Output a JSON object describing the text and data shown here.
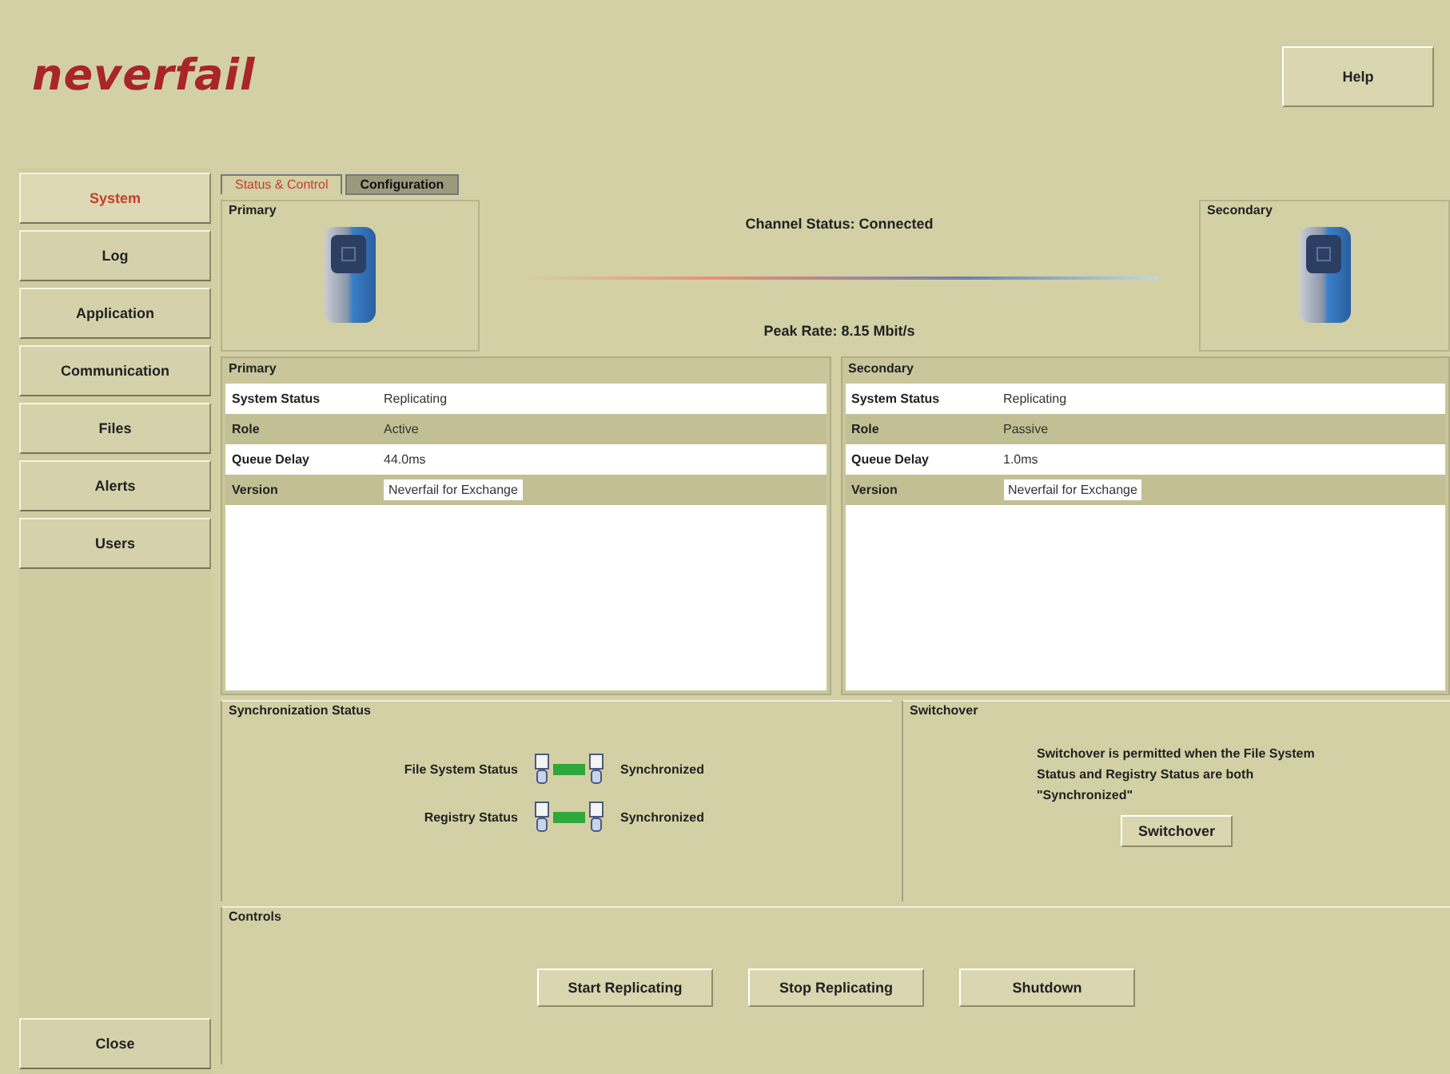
{
  "logo": "neverfail",
  "help_button": "Help",
  "sidebar": {
    "items": [
      {
        "label": "System",
        "selected": true
      },
      {
        "label": "Log",
        "selected": false
      },
      {
        "label": "Application",
        "selected": false
      },
      {
        "label": "Communication",
        "selected": false
      },
      {
        "label": "Files",
        "selected": false
      },
      {
        "label": "Alerts",
        "selected": false
      },
      {
        "label": "Users",
        "selected": false
      }
    ],
    "close_button": "Close"
  },
  "tabs": [
    {
      "label": "Status & Control",
      "selected": true
    },
    {
      "label": "Configuration",
      "selected": false
    }
  ],
  "channel": {
    "primary_title": "Primary",
    "secondary_title": "Secondary",
    "status": "Channel Status: Connected",
    "peak_rate": "Peak Rate: 8.15 Mbit/s"
  },
  "servers": [
    {
      "title": "Primary",
      "rows": [
        {
          "label": "System Status",
          "value": "Replicating",
          "kind": "text"
        },
        {
          "label": "Role",
          "value": "Active",
          "kind": "text"
        },
        {
          "label": "Queue Delay",
          "value": "44.0ms",
          "kind": "text"
        },
        {
          "label": "Version",
          "value": "Neverfail for Exchange",
          "kind": "field"
        }
      ]
    },
    {
      "title": "Secondary",
      "rows": [
        {
          "label": "System Status",
          "value": "Replicating",
          "kind": "text"
        },
        {
          "label": "Role",
          "value": "Passive",
          "kind": "text"
        },
        {
          "label": "Queue Delay",
          "value": "1.0ms",
          "kind": "text"
        },
        {
          "label": "Version",
          "value": "Neverfail for Exchange",
          "kind": "field"
        }
      ]
    }
  ],
  "synchronization": {
    "title": "Synchronization Status",
    "rows": [
      {
        "label": "File System Status",
        "status": "Synchronized",
        "synchronized": true
      },
      {
        "label": "Registry Status",
        "status": "Synchronized",
        "synchronized": true
      }
    ]
  },
  "switchover": {
    "title": "Switchover",
    "message": "Switchover is permitted when the File System Status and Registry Status are both \"Synchronized\"",
    "button": "Switchover"
  },
  "controls": {
    "title": "Controls",
    "buttons": [
      "Start Replicating",
      "Stop Replicating",
      "Shutdown"
    ]
  }
}
